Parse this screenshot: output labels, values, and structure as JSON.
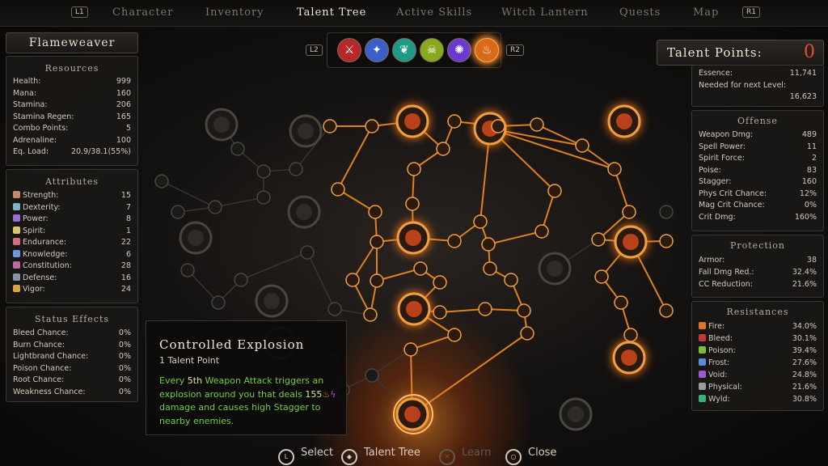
{
  "nav": {
    "left_badge": "L1",
    "right_badge": "R1",
    "tabs": [
      "Character",
      "Inventory",
      "Talent Tree",
      "Active Skills",
      "Witch Lantern",
      "Quests",
      "Map"
    ],
    "active_tab": "Talent Tree"
  },
  "class_name": "Flameweaver",
  "resources": {
    "title": "Resources",
    "rows": [
      {
        "label": "Health:",
        "value": "999"
      },
      {
        "label": "Mana:",
        "value": "160"
      },
      {
        "label": "Stamina:",
        "value": "206"
      },
      {
        "label": "Stamina Regen:",
        "value": "165"
      },
      {
        "label": "Combo Points:",
        "value": "5"
      },
      {
        "label": "Adrenaline:",
        "value": "100"
      },
      {
        "label": "Eq. Load:",
        "value": "20.9/38.1(55%)"
      }
    ]
  },
  "attributes": {
    "title": "Attributes",
    "rows": [
      {
        "label": "Strength:",
        "value": "15",
        "color": "#c9856c"
      },
      {
        "label": "Dexterity:",
        "value": "7",
        "color": "#7fb0c9"
      },
      {
        "label": "Power:",
        "value": "8",
        "color": "#9b6fd1"
      },
      {
        "label": "Spirit:",
        "value": "1",
        "color": "#d8c46a"
      },
      {
        "label": "Endurance:",
        "value": "22",
        "color": "#d46f7c"
      },
      {
        "label": "Knowledge:",
        "value": "6",
        "color": "#6a9ad8"
      },
      {
        "label": "Constitution:",
        "value": "28",
        "color": "#c06a9a"
      },
      {
        "label": "Defense:",
        "value": "16",
        "color": "#8a96a8"
      },
      {
        "label": "Vigor:",
        "value": "24",
        "color": "#d6a24a"
      }
    ]
  },
  "status_effects": {
    "title": "Status Effects",
    "rows": [
      {
        "label": "Bleed Chance:",
        "value": "0%"
      },
      {
        "label": "Burn Chance:",
        "value": "0%"
      },
      {
        "label": "Lightbrand Chance:",
        "value": "0%"
      },
      {
        "label": "Poison Chance:",
        "value": "0%"
      },
      {
        "label": "Root Chance:",
        "value": "0%"
      },
      {
        "label": "Weakness Chance:",
        "value": "0%"
      }
    ]
  },
  "talent_points": {
    "label": "Talent Points:",
    "value": "0"
  },
  "essence": {
    "rows": [
      {
        "label": "Essence:",
        "value": "11,741"
      },
      {
        "label": "Needed for next Level:",
        "value": ""
      },
      {
        "label": "",
        "value": "16,623"
      }
    ]
  },
  "offense": {
    "title": "Offense",
    "rows": [
      {
        "label": "Weapon Dmg:",
        "value": "489"
      },
      {
        "label": "Spell Power:",
        "value": "11"
      },
      {
        "label": "Spirit Force:",
        "value": "2"
      },
      {
        "label": "Poise:",
        "value": "83"
      },
      {
        "label": "Stagger:",
        "value": "160"
      },
      {
        "label": "Phys Crit Chance:",
        "value": "12%"
      },
      {
        "label": "Mag Crit Chance:",
        "value": "0%"
      },
      {
        "label": "Crit Dmg:",
        "value": "160%"
      }
    ]
  },
  "protection": {
    "title": "Protection",
    "rows": [
      {
        "label": "Armor:",
        "value": "38"
      },
      {
        "label": "Fall Dmg Red.:",
        "value": "32.4%"
      },
      {
        "label": "CC Reduction:",
        "value": "21.6%"
      }
    ]
  },
  "resistances": {
    "title": "Resistances",
    "rows": [
      {
        "label": "Fire:",
        "value": "34.0%",
        "color": "#e0742a"
      },
      {
        "label": "Bleed:",
        "value": "30.1%",
        "color": "#c43a3a"
      },
      {
        "label": "Poison:",
        "value": "39.4%",
        "color": "#7dbb3a"
      },
      {
        "label": "Frost:",
        "value": "27.6%",
        "color": "#5a8fd8"
      },
      {
        "label": "Void:",
        "value": "24.8%",
        "color": "#a05ad0"
      },
      {
        "label": "Physical:",
        "value": "21.6%",
        "color": "#9a9a9a"
      },
      {
        "label": "Wyld:",
        "value": "30.8%",
        "color": "#3ab07a"
      }
    ]
  },
  "schools": {
    "left_badge": "L2",
    "right_badge": "R2",
    "items": [
      {
        "icon": "sword-school-icon",
        "glyph": "⚔",
        "color": "#b8282a"
      },
      {
        "icon": "light-school-icon",
        "glyph": "✦",
        "color": "#3a5fc8"
      },
      {
        "icon": "tree-school-icon",
        "glyph": "❦",
        "color": "#1f9a86"
      },
      {
        "icon": "skull-school-icon",
        "glyph": "☠",
        "color": "#8aa81c"
      },
      {
        "icon": "void-school-icon",
        "glyph": "✺",
        "color": "#6a3ad0"
      },
      {
        "icon": "fire-school-icon",
        "glyph": "♨",
        "color": "#d86a1a"
      }
    ],
    "selected": 5
  },
  "tooltip": {
    "title": "Controlled Explosion",
    "cost": "1 Talent Point",
    "desc_1": "Every ",
    "desc_hl1": "5th",
    "desc_2": " Weapon Attack triggers an explosion around you that deals ",
    "desc_hl2": "155",
    "desc_3": " damage and causes high Stagger to nearby enemies."
  },
  "bottom_bar": {
    "items": [
      {
        "glyph": "L",
        "label": "Select",
        "enabled": true
      },
      {
        "glyph": "◆",
        "label": "Talent Tree",
        "enabled": true
      },
      {
        "glyph": "✕",
        "label": "Learn",
        "enabled": false
      },
      {
        "glyph": "○",
        "label": "Close",
        "enabled": true
      }
    ]
  }
}
